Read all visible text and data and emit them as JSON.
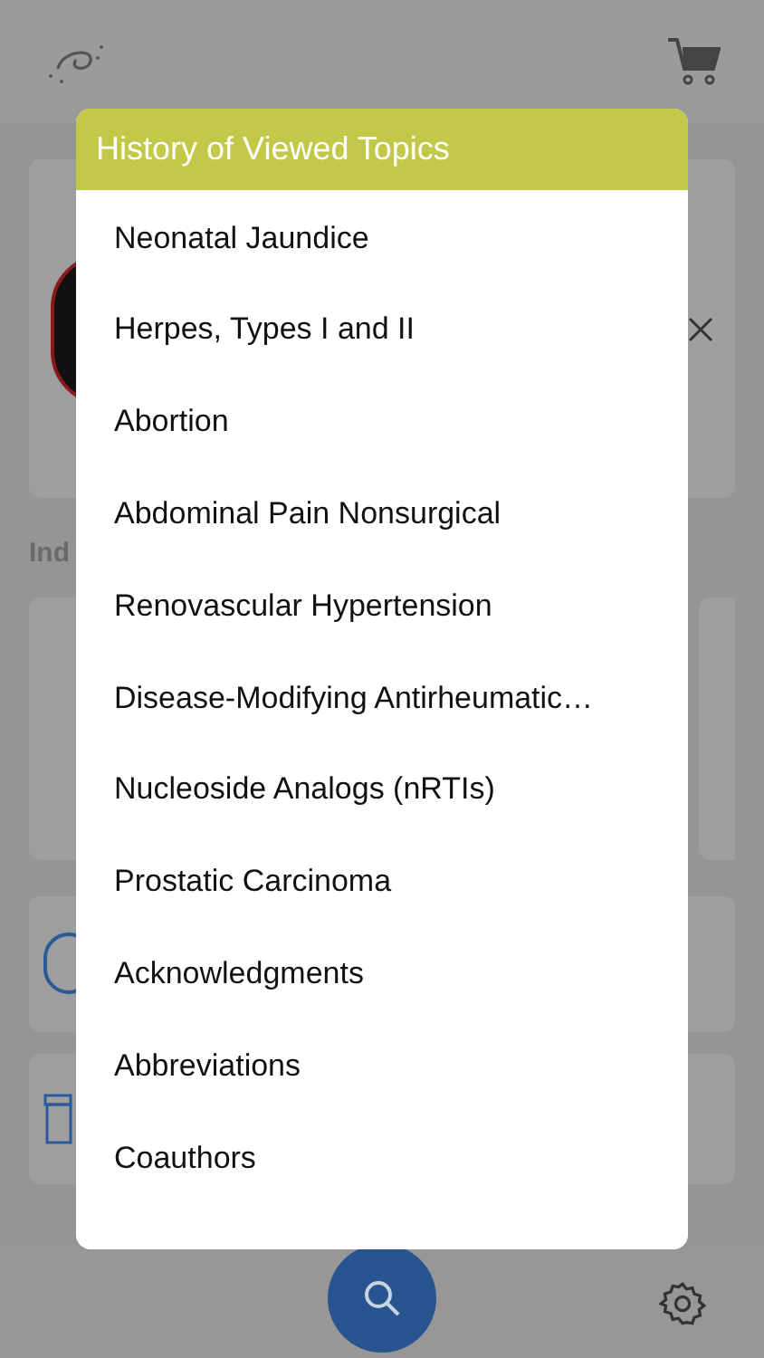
{
  "background": {
    "section_label": "Ind"
  },
  "dialog": {
    "title": "History of Viewed Topics",
    "items": [
      {
        "label": "Neonatal Jaundice"
      },
      {
        "label": "Herpes, Types I and II"
      },
      {
        "label": "Abortion"
      },
      {
        "label": "Abdominal Pain Nonsurgical"
      },
      {
        "label": "Renovascular Hypertension"
      },
      {
        "label": "Disease-Modifying Antirheumatic…"
      },
      {
        "label": "Nucleoside Analogs (nRTIs)"
      },
      {
        "label": "Prostatic Carcinoma"
      },
      {
        "label": "Acknowledgments"
      },
      {
        "label": "Abbreviations"
      },
      {
        "label": "Coauthors"
      }
    ]
  }
}
